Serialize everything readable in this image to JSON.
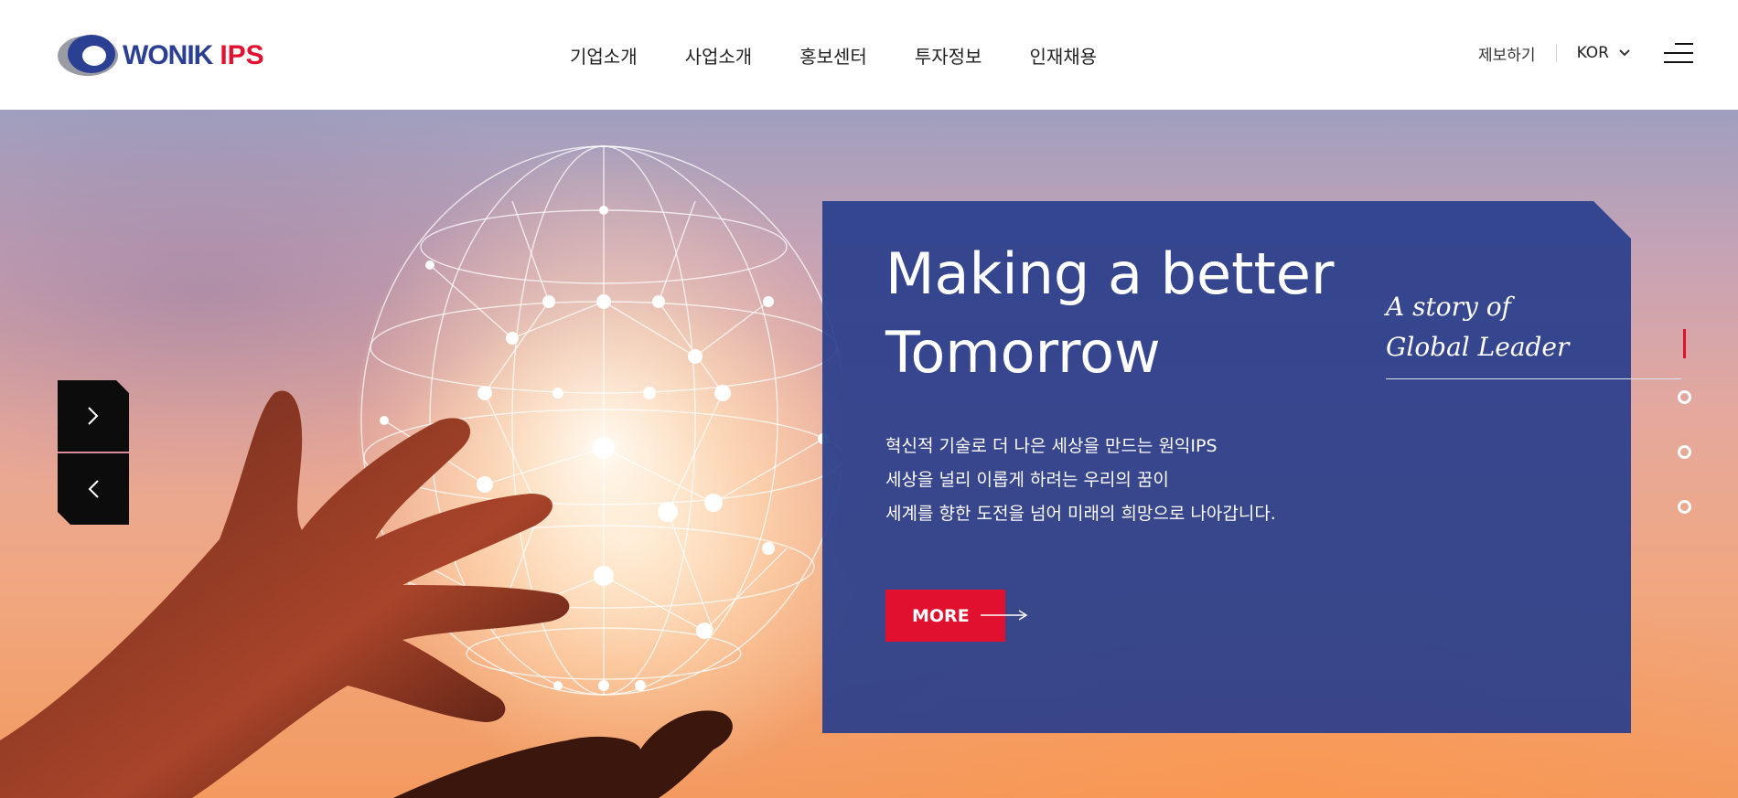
{
  "brand": {
    "word": "WONIK",
    "suffix": "IPS"
  },
  "nav": {
    "items": [
      {
        "label": "기업소개"
      },
      {
        "label": "사업소개"
      },
      {
        "label": "홍보센터"
      },
      {
        "label": "투자정보"
      },
      {
        "label": "인재채용"
      }
    ]
  },
  "utility": {
    "report_label": "제보하기",
    "language": "KOR",
    "menu_icon": "hamburger-menu-icon",
    "language_icon": "chevron-down-icon"
  },
  "hero": {
    "headline_line1": "Making a better",
    "headline_line2": "Tomorrow",
    "story_line1": "A story of",
    "story_line2": "Global Leader",
    "description": [
      "혁신적 기술로 더 나은 세상을 만드는 원익IPS",
      "세상을 널리 이롭게 하려는 우리의 꿈이",
      "세계를 향한 도전을 넘어 미래의 희망으로 나아갑니다."
    ],
    "more_label": "MORE",
    "slider": {
      "total": 4,
      "active": 1
    }
  },
  "colors": {
    "brand_blue": "#2b3f93",
    "brand_red": "#e2112f",
    "panel_blue": "#283e8c"
  }
}
